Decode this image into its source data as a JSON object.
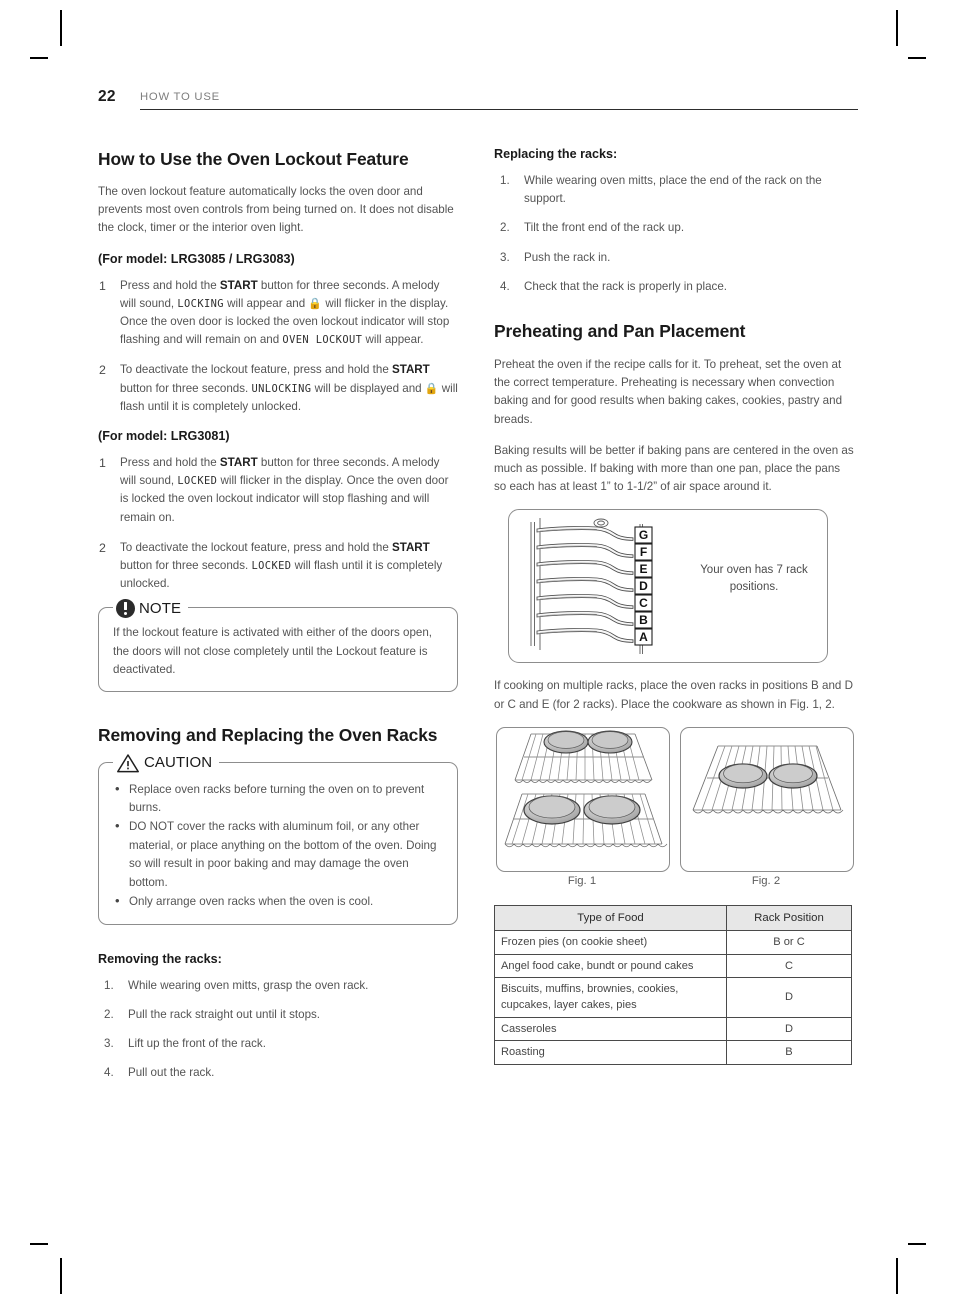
{
  "running_head": {
    "page_number": "22",
    "section": "HOW TO USE"
  },
  "left_column": {
    "lockout": {
      "title": "How to Use the Oven Lockout Feature",
      "intro": "The oven lockout feature automatically locks the oven door and prevents most oven controls from being turned on. It does not disable the clock, timer or the interior oven light.",
      "model_heading_a": "(For model: LRG3085 / LRG3083)",
      "steps_a": [
        {
          "num": "1",
          "parts": [
            {
              "t": "Press and hold the ",
              "s": "plain"
            },
            {
              "t": "START",
              "s": "bold"
            },
            {
              "t": " button for three seconds. A melody will sound, ",
              "s": "plain"
            },
            {
              "t": "LOCKING",
              "s": "lcd"
            },
            {
              "t": " will appear and ",
              "s": "plain"
            },
            {
              "t": "lock-icon",
              "s": "lock"
            },
            {
              "t": " will flicker in the display. Once the oven door is locked the oven lockout indicator will stop flashing and will remain on and ",
              "s": "plain"
            },
            {
              "t": "OVEN LOCKOUT",
              "s": "lcd"
            },
            {
              "t": " will appear.",
              "s": "plain"
            }
          ]
        },
        {
          "num": "2",
          "parts": [
            {
              "t": "To deactivate the lockout feature, press and hold the ",
              "s": "plain"
            },
            {
              "t": "START",
              "s": "bold"
            },
            {
              "t": " button for three seconds. ",
              "s": "plain"
            },
            {
              "t": "UNLOCKING",
              "s": "lcd"
            },
            {
              "t": " will be displayed and ",
              "s": "plain"
            },
            {
              "t": "lock-icon",
              "s": "lock"
            },
            {
              "t": " will flash until it is completely unlocked.",
              "s": "plain"
            }
          ]
        }
      ],
      "model_heading_b": "(For model: LRG3081)",
      "steps_b": [
        {
          "num": "1",
          "parts": [
            {
              "t": "Press and hold the ",
              "s": "plain"
            },
            {
              "t": "START",
              "s": "bold"
            },
            {
              "t": " button for three seconds. A melody will sound, ",
              "s": "plain"
            },
            {
              "t": "LOCKED",
              "s": "lcd"
            },
            {
              "t": " will flicker in the display. Once the oven door is locked the oven lockout indicator will stop flashing and will remain on.",
              "s": "plain"
            }
          ]
        },
        {
          "num": "2",
          "parts": [
            {
              "t": "To deactivate the lockout feature, press and hold the ",
              "s": "plain"
            },
            {
              "t": "START",
              "s": "bold"
            },
            {
              "t": " button for three seconds. ",
              "s": "plain"
            },
            {
              "t": "LOCKED",
              "s": "lcd"
            },
            {
              "t": " will flash until it is completely unlocked.",
              "s": "plain"
            }
          ]
        }
      ],
      "note": {
        "label": "NOTE",
        "text": "If the lockout feature is activated with either of the doors open, the doors will not close completely until the Lockout feature is deactivated."
      }
    },
    "racks": {
      "title": "Removing and Replacing the Oven Racks",
      "caution": {
        "label": "CAUTION",
        "bullets": [
          "Replace oven racks before turning the oven on to prevent burns.",
          "DO NOT cover the racks with aluminum foil, or any other material, or place anything on the bottom of the oven. Doing so will result in poor baking and may damage the oven bottom.",
          "Only arrange oven racks when the oven is cool."
        ]
      },
      "removing_heading": "Removing the racks:",
      "removing_steps": [
        "While wearing oven mitts, grasp the oven rack.",
        "Pull the rack straight out until it stops.",
        "Lift up the front of the rack.",
        "Pull out the rack."
      ]
    }
  },
  "right_column": {
    "replacing_heading": "Replacing the racks:",
    "replacing_steps": [
      "While wearing oven mitts, place the end of the rack on the support.",
      "Tilt the front end of the rack up.",
      "Push the rack in.",
      "Check that the rack is properly in place."
    ],
    "preheating": {
      "title": "Preheating and Pan Placement",
      "para1": "Preheat the oven if the recipe calls for it. To preheat, set the oven at the correct temperature. Preheating is necessary when convection baking and for good results when baking cakes, cookies, pastry and breads.",
      "para2": "Baking results will be better if baking pans are centered in the oven as much as possible. If baking with more than one pan, place the pans so each has at least 1” to 1-1/2” of air space around it.",
      "rack_diagram": {
        "labels": [
          "G",
          "F",
          "E",
          "D",
          "C",
          "B",
          "A"
        ],
        "caption": "Your oven has 7 rack positions."
      },
      "para3": "If cooking on multiple racks, place the oven racks in positions B and D or C and E (for 2 racks). Place the cookware as shown in Fig. 1, 2.",
      "fig1_caption": "Fig. 1",
      "fig2_caption": "Fig. 2"
    },
    "rack_table": {
      "headers": [
        "Type of Food",
        "Rack Position"
      ],
      "rows": [
        {
          "food": "Frozen pies (on cookie sheet)",
          "position": "B or C"
        },
        {
          "food": "Angel food cake, bundt or pound cakes",
          "position": "C"
        },
        {
          "food": "Biscuits, muffins, brownies, cookies, cupcakes, layer cakes, pies",
          "position": "D"
        },
        {
          "food": "Casseroles",
          "position": "D"
        },
        {
          "food": "Roasting",
          "position": "B"
        }
      ]
    }
  }
}
